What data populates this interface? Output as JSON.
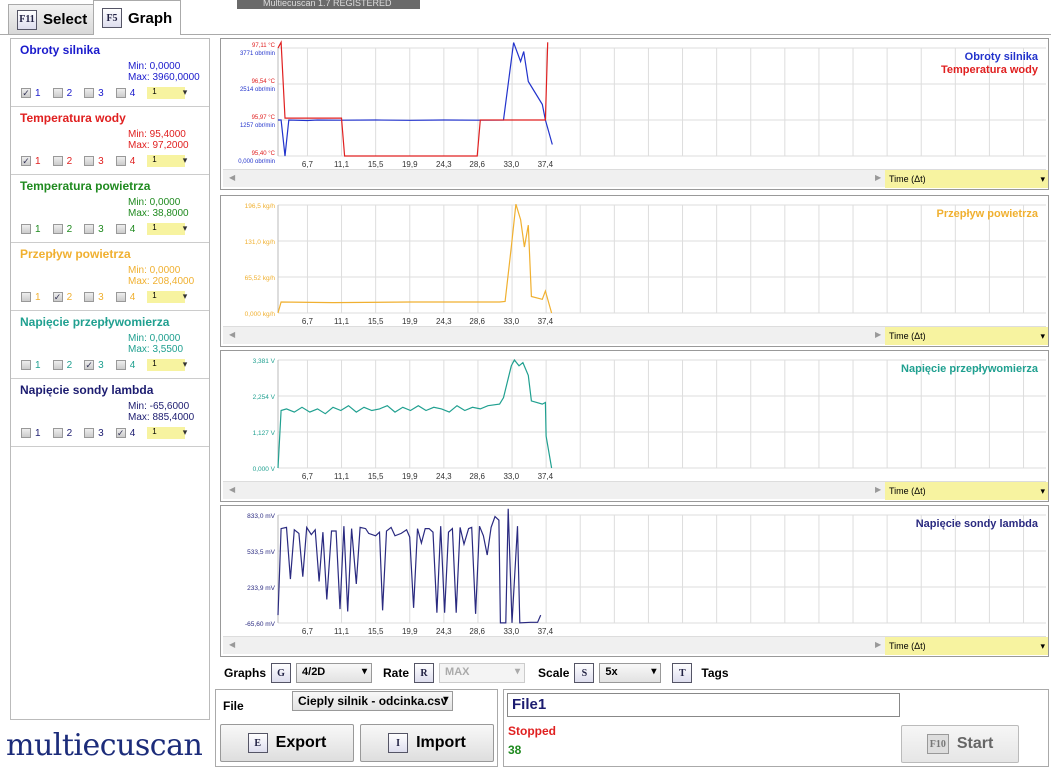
{
  "overlay_window_title": "Multiecuscan 1.7 REGISTERED",
  "tabs": [
    {
      "key": "F11",
      "label": "Select",
      "active": false
    },
    {
      "key": "F5",
      "label": "Graph",
      "active": true
    }
  ],
  "sensors": [
    {
      "name": "Obroty silnika",
      "min": "Min: 0,0000",
      "max": "Max: 3960,0000",
      "color": "#1a1acc",
      "checked": 1,
      "scale": "1"
    },
    {
      "name": "Temperatura wody",
      "min": "Min: 95,4000",
      "max": "Max: 97,2000",
      "color": "#e02020",
      "checked": 1,
      "scale": "1"
    },
    {
      "name": "Temperatura powietrza",
      "min": "Min: 0,0000",
      "max": "Max: 38,8000",
      "color": "#1f8a1f",
      "checked": 0,
      "scale": "1"
    },
    {
      "name": "Przepływ powietrza",
      "min": "Min: 0,0000",
      "max": "Max: 208,4000",
      "color": "#f0b030",
      "checked": 2,
      "scale": "1"
    },
    {
      "name": "Napięcie przepływomierza",
      "min": "Min: 0,0000",
      "max": "Max: 3,5500",
      "color": "#20a090",
      "checked": 3,
      "scale": "1"
    },
    {
      "name": "Napięcie sondy lambda",
      "min": "Min: -65,6000",
      "max": "Max: 885,4000",
      "color": "#1c1c70",
      "checked": 4,
      "scale": "1"
    }
  ],
  "checkbox_labels": [
    "1",
    "2",
    "3",
    "4"
  ],
  "x_axis_label": "Time (Δt)",
  "chart_data": [
    {
      "type": "line",
      "xticks": [
        "6,7",
        "11,1",
        "15,5",
        "19,9",
        "24,3",
        "28,6",
        "33,0",
        "37,4"
      ],
      "xtick_values": [
        6.7,
        11.1,
        15.5,
        19.9,
        24.3,
        28.6,
        33.0,
        37.4
      ],
      "xlim": [
        2.9,
        102
      ],
      "series": [
        {
          "name": "Obroty silnika",
          "color": "#2233cc",
          "ylim": [
            0,
            3771
          ],
          "yticks": [
            "3771 obr/min",
            "2514 obr/min",
            "1257 obr/min",
            "0,000 obr/min"
          ],
          "points": [
            [
              2.9,
              1257
            ],
            [
              3.3,
              1257
            ],
            [
              3.8,
              0
            ],
            [
              4.3,
              1257
            ],
            [
              6.7,
              1240
            ],
            [
              8,
              1257
            ],
            [
              11.1,
              1250
            ],
            [
              15.5,
              1257
            ],
            [
              19.9,
              1245
            ],
            [
              24.3,
              1257
            ],
            [
              28.6,
              1250
            ],
            [
              32.0,
              1257
            ],
            [
              33.3,
              3960
            ],
            [
              34.2,
              3300
            ],
            [
              34.6,
              3650
            ],
            [
              35.2,
              2600
            ],
            [
              37.0,
              1800
            ],
            [
              37.4,
              1257
            ],
            [
              38.3,
              400
            ]
          ]
        },
        {
          "name": "Temperatura wody",
          "color": "#e02020",
          "ylim": [
            95.4,
            97.11
          ],
          "yticks": [
            "97,11 °C",
            "96,54 °C",
            "95,97 °C",
            "95,40 °C"
          ],
          "points": [
            [
              2.9,
              97.11
            ],
            [
              3.3,
              97.2
            ],
            [
              3.8,
              96.0
            ],
            [
              11.1,
              96.0
            ],
            [
              11.5,
              95.4
            ],
            [
              28.6,
              95.4
            ],
            [
              29.0,
              95.97
            ],
            [
              37.4,
              95.97
            ],
            [
              37.7,
              97.2
            ]
          ]
        }
      ]
    },
    {
      "type": "line",
      "xticks": [
        "6,7",
        "11,1",
        "15,5",
        "19,9",
        "24,3",
        "28,6",
        "33,0",
        "37,4"
      ],
      "xtick_values": [
        6.7,
        11.1,
        15.5,
        19.9,
        24.3,
        28.6,
        33.0,
        37.4
      ],
      "xlim": [
        2.9,
        102
      ],
      "series": [
        {
          "name": "Przepływ powietrza",
          "color": "#f0b030",
          "ylim": [
            0,
            196.5
          ],
          "yticks": [
            "196,5 kg/h",
            "131,0 kg/h",
            "65,52 kg/h",
            "0,000 kg/h"
          ],
          "points": [
            [
              2.9,
              0
            ],
            [
              3.3,
              20
            ],
            [
              10,
              19
            ],
            [
              20,
              20
            ],
            [
              31.5,
              20
            ],
            [
              32.2,
              21
            ],
            [
              33.0,
              120
            ],
            [
              33.6,
              198
            ],
            [
              34.2,
              170
            ],
            [
              34.7,
              120
            ],
            [
              35.2,
              160
            ],
            [
              35.6,
              30
            ],
            [
              37.0,
              25
            ],
            [
              37.4,
              40
            ],
            [
              38.2,
              0
            ]
          ]
        }
      ]
    },
    {
      "type": "line",
      "xticks": [
        "6,7",
        "11,1",
        "15,5",
        "19,9",
        "24,3",
        "28,6",
        "33,0",
        "37,4"
      ],
      "xtick_values": [
        6.7,
        11.1,
        15.5,
        19.9,
        24.3,
        28.6,
        33.0,
        37.4
      ],
      "xlim": [
        2.9,
        102
      ],
      "series": [
        {
          "name": "Napięcie przepływomierza",
          "color": "#20a090",
          "ylim": [
            0,
            3.381
          ],
          "yticks": [
            "3,381 V",
            "2,254 V",
            "1,127 V",
            "0,000 V"
          ],
          "points": [
            [
              2.9,
              0
            ],
            [
              3.3,
              1.8
            ],
            [
              4,
              1.85
            ],
            [
              5,
              1.75
            ],
            [
              6,
              1.9
            ],
            [
              7,
              1.75
            ],
            [
              8,
              1.85
            ],
            [
              9,
              1.7
            ],
            [
              10,
              1.9
            ],
            [
              11,
              1.8
            ],
            [
              12,
              1.95
            ],
            [
              13,
              1.75
            ],
            [
              14,
              1.9
            ],
            [
              15,
              1.8
            ],
            [
              16,
              1.85
            ],
            [
              17,
              1.95
            ],
            [
              18,
              1.75
            ],
            [
              19,
              1.9
            ],
            [
              20,
              1.8
            ],
            [
              21,
              1.95
            ],
            [
              22,
              1.8
            ],
            [
              23,
              1.9
            ],
            [
              24,
              1.85
            ],
            [
              25,
              1.75
            ],
            [
              26,
              1.95
            ],
            [
              27,
              1.8
            ],
            [
              28,
              1.9
            ],
            [
              29,
              1.85
            ],
            [
              30,
              1.95
            ],
            [
              31.5,
              2.0
            ],
            [
              32,
              2.2
            ],
            [
              33,
              3.2
            ],
            [
              33.4,
              3.38
            ],
            [
              34,
              3.2
            ],
            [
              34.5,
              3.3
            ],
            [
              35.2,
              2.9
            ],
            [
              35.6,
              2.1
            ],
            [
              37,
              2.0
            ],
            [
              37.4,
              2.05
            ],
            [
              37.5,
              1.0
            ],
            [
              38.2,
              0
            ]
          ]
        }
      ]
    },
    {
      "type": "line",
      "xticks": [
        "6,7",
        "11,1",
        "15,5",
        "19,9",
        "24,3",
        "28,6",
        "33,0",
        "37,4"
      ],
      "xtick_values": [
        6.7,
        11.1,
        15.5,
        19.9,
        24.3,
        28.6,
        33.0,
        37.4
      ],
      "xlim": [
        2.9,
        102
      ],
      "series": [
        {
          "name": "Napięcie sondy lambda",
          "color": "#2a2a80",
          "ylim": [
            -65.6,
            833.0
          ],
          "yticks": [
            "833,0 mV",
            "533,5 mV",
            "233,9 mV",
            "-65,60 mV"
          ],
          "points": [
            [
              2.9,
              0
            ],
            [
              3.3,
              720
            ],
            [
              4,
              730
            ],
            [
              4.5,
              300
            ],
            [
              5,
              710
            ],
            [
              5.6,
              680
            ],
            [
              6.1,
              320
            ],
            [
              6.6,
              730
            ],
            [
              7.2,
              670
            ],
            [
              7.7,
              710
            ],
            [
              8.2,
              280
            ],
            [
              8.7,
              690
            ],
            [
              9.2,
              130
            ],
            [
              9.8,
              700
            ],
            [
              10.4,
              700
            ],
            [
              10.9,
              50
            ],
            [
              11.4,
              740
            ],
            [
              11.9,
              30
            ],
            [
              12.4,
              720
            ],
            [
              13,
              260
            ],
            [
              13.5,
              730
            ],
            [
              14.2,
              720
            ],
            [
              14.6,
              680
            ],
            [
              15.5,
              660
            ],
            [
              16,
              690
            ],
            [
              16.4,
              40
            ],
            [
              16.9,
              700
            ],
            [
              17.5,
              730
            ],
            [
              18,
              660
            ],
            [
              18.8,
              680
            ],
            [
              19.5,
              710
            ],
            [
              19.9,
              650
            ],
            [
              20.4,
              60
            ],
            [
              20.9,
              720
            ],
            [
              21.4,
              600
            ],
            [
              21.9,
              720
            ],
            [
              22.4,
              720
            ],
            [
              22.9,
              690
            ],
            [
              23.4,
              20
            ],
            [
              23.9,
              740
            ],
            [
              24.4,
              20
            ],
            [
              24.9,
              690
            ],
            [
              25.4,
              720
            ],
            [
              25.9,
              20
            ],
            [
              26.4,
              730
            ],
            [
              26.9,
              590
            ],
            [
              27.5,
              720
            ],
            [
              27.9,
              730
            ],
            [
              28.4,
              10
            ],
            [
              28.9,
              740
            ],
            [
              29.4,
              660
            ],
            [
              29.9,
              500
            ],
            [
              30.4,
              730
            ],
            [
              30.9,
              820
            ],
            [
              31.4,
              790
            ],
            [
              31.6,
              -65
            ],
            [
              32.3,
              -65
            ],
            [
              32.6,
              885
            ],
            [
              33.1,
              -65
            ],
            [
              33.8,
              740
            ],
            [
              34.1,
              -65
            ],
            [
              35.5,
              -60
            ],
            [
              36.4,
              -60
            ],
            [
              36.8,
              0
            ]
          ]
        }
      ]
    }
  ],
  "controls": {
    "graphs_label": "Graphs",
    "graphs_key": "G",
    "graphs_value": "4/2D",
    "rate_label": "Rate",
    "rate_key": "R",
    "rate_value": "MAX",
    "scale_label": "Scale",
    "scale_key": "S",
    "scale_value": "5x",
    "tags_key": "T",
    "tags_label": "Tags"
  },
  "file": {
    "label": "File",
    "selected": "Cieply silnik - odcinka.csv",
    "export_key": "E",
    "export_label": "Export",
    "import_key": "I",
    "import_label": "Import"
  },
  "status": {
    "name_value": "File1",
    "state": "Stopped",
    "count": "38",
    "start_key": "F10",
    "start_label": "Start"
  },
  "logo_text": "multiecuscan"
}
